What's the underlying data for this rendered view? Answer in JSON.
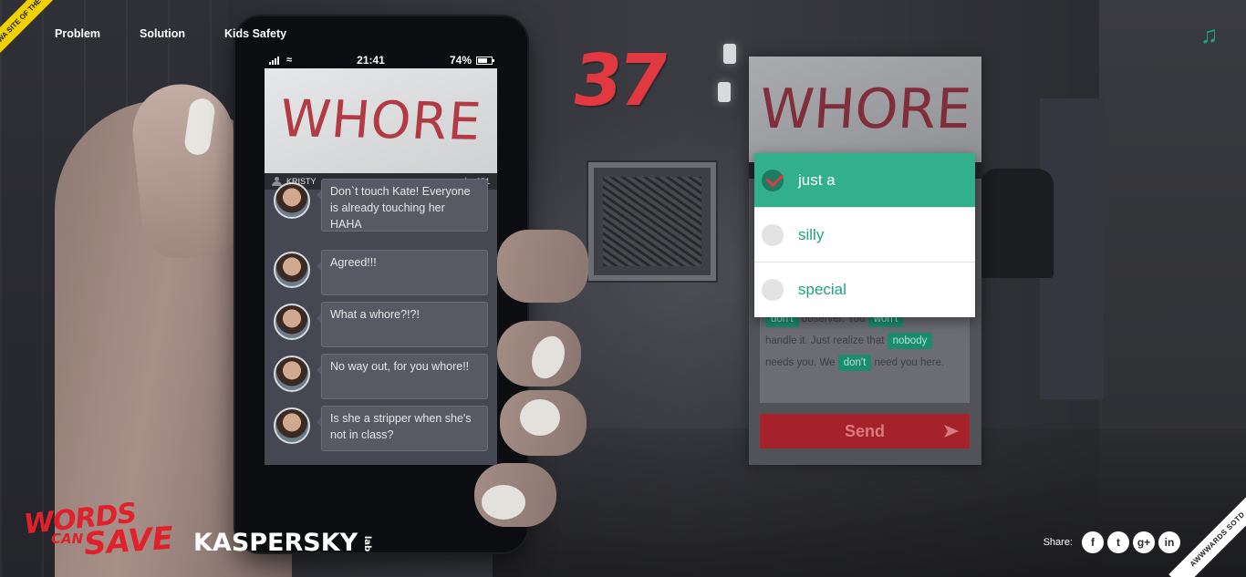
{
  "nav": {
    "badge": "FWA SITE OF THE DAY",
    "items": [
      "Problem",
      "Solution",
      "Kids Safety"
    ]
  },
  "icons": {
    "music": "music-note-icon",
    "signal": "signal-bars-icon",
    "wifi": "wifi-icon",
    "battery": "battery-icon",
    "user": "user-icon",
    "like": "thumbs-up-icon",
    "send": "send-arrow-icon"
  },
  "colors": {
    "accent_green": "#32b08c",
    "brand_red": "#e2383f",
    "send_red": "#a6222b"
  },
  "phone": {
    "status": {
      "time": "21:41",
      "battery": "74%"
    },
    "post": {
      "word": "WHORE",
      "user": "KRISTY",
      "likes": "351"
    },
    "comments": [
      {
        "text": "Don`t touch Kate! Everyone is already touching her HAHA"
      },
      {
        "text": "Agreed!!!"
      },
      {
        "text": "What a whore?!?!"
      },
      {
        "text": "No way out, for you whore!!"
      },
      {
        "text": "Is she a stripper when she's not in class?"
      }
    ]
  },
  "counter": "37",
  "panel": {
    "word": "WHORE",
    "message": {
      "line1_end": "observer. You",
      "chip1": "don't",
      "chip2": "won't",
      "line2_start": "handle it. Just realize that",
      "chip3": "nobody",
      "line3_start": "needs you. We",
      "chip4": "don't",
      "line3_end": "need you here."
    },
    "send_label": "Send"
  },
  "dropdown": {
    "selected": "just a",
    "options": [
      "just a",
      "silly",
      "special"
    ]
  },
  "footer": {
    "logo_line1": "WORDS",
    "logo_line2": "CAN",
    "logo_line3": "SAVE",
    "kaspersky": "KASPERSKY",
    "kaspersky_lab": "lab",
    "share_label": "Share:",
    "social": [
      "f",
      "t",
      "g+",
      "in"
    ],
    "awwwards": "AWWWARDS SOTD"
  }
}
